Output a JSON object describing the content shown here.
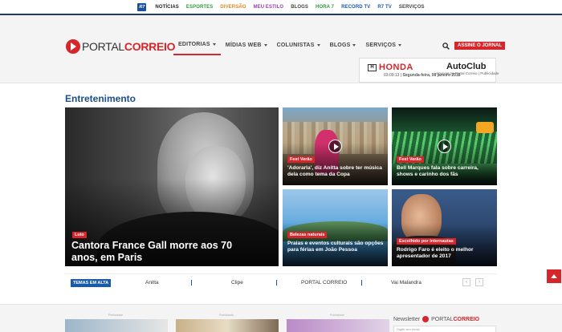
{
  "topbar": {
    "logo": "R7",
    "links": [
      {
        "label": "NOTÍCIAS",
        "color": "#222222"
      },
      {
        "label": "ESPORTES",
        "color": "#2e9c3a"
      },
      {
        "label": "DIVERSÃO",
        "color": "#e8871e"
      },
      {
        "label": "MEU ESTILO",
        "color": "#9a3fb5"
      },
      {
        "label": "BLOGS",
        "color": "#444444"
      },
      {
        "label": "HORA 7",
        "color": "#2e9c3a"
      },
      {
        "label": "RECORD TV",
        "color": "#1b5aa6"
      },
      {
        "label": "R7 TV",
        "color": "#1b5aa6"
      },
      {
        "label": "SERVIÇOS",
        "color": "#444444"
      }
    ]
  },
  "header": {
    "logo_light": "PORTAL",
    "logo_bold": "CORREIO",
    "nav": [
      {
        "label": "EDITORIAS"
      },
      {
        "label": "MÍDIAS WEB"
      },
      {
        "label": "COLUNISTAS"
      },
      {
        "label": "BLOGS"
      },
      {
        "label": "SERVIÇOS"
      }
    ],
    "subscribe": "ASSINE O JORNAL",
    "ad": {
      "brand": "HONDA",
      "h_mark": "H",
      "product": "AutoClub",
      "time": "03:09:13",
      "date": "Segunda-feira, 08 janeiro 2018"
    },
    "ad_caption": "Anuncie no Portal Correio | Publicidade"
  },
  "section": {
    "title": "Entretenimento",
    "main_card": {
      "tag": "Luto",
      "headline": "Cantora France Gall morre aos 70 anos, em Paris"
    },
    "cards": [
      {
        "tag": "Fest Verão",
        "headline": "'Adorarla', diz Anitta sobre ter música dela como tema da Copa"
      },
      {
        "tag": "Fest Verão",
        "headline": "Bell Marques fala sobre carreira, shows e carinho dos fãs"
      },
      {
        "tag": "Belezas naturais",
        "headline": "Praias e eventos culturais são opções para férias em João Pessoa"
      },
      {
        "tag": "Escolhido por internautas",
        "headline": "Rodrigo Faro é eleito o melhor apresentador de 2017"
      }
    ]
  },
  "trending": {
    "label": "TEMAS EM ALTA",
    "items": [
      "Anitta",
      "Clipe",
      "PORTAL CORREIO",
      "Vai Malandra"
    ]
  },
  "bottom": {
    "publicidade": "Publicidade",
    "newsletter_label": "Newsletter",
    "newsletter_logo_light": "PORTAL",
    "newsletter_logo_bold": "CORREIO",
    "newsletter_placeholder": "Digite seu email"
  },
  "colors": {
    "brand_red": "#d6252b",
    "accent_blue": "#1b4f8c"
  }
}
